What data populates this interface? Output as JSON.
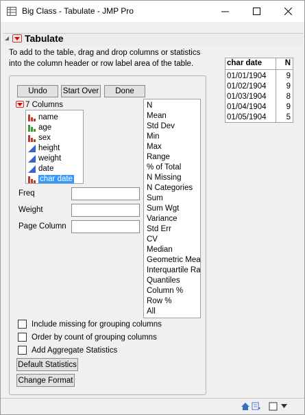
{
  "window": {
    "title": "Big Class - Tabulate - JMP Pro",
    "minimize_glyph": "—",
    "maximize_glyph": "☐",
    "close_glyph": "✕"
  },
  "outline": {
    "title": "Tabulate",
    "instructions": "To add to the table, drag and drop columns or statistics into the column header or row label area of the table."
  },
  "buttons": {
    "undo": "Undo",
    "start_over": "Start Over",
    "done": "Done",
    "default_statistics": "Default Statistics",
    "change_format": "Change Format"
  },
  "columns": {
    "header": "7 Columns",
    "items": [
      {
        "label": "name",
        "icon": "nominal-icon"
      },
      {
        "label": "age",
        "icon": "ordinal-icon"
      },
      {
        "label": "sex",
        "icon": "nominal-icon"
      },
      {
        "label": "height",
        "icon": "continuous-icon"
      },
      {
        "label": "weight",
        "icon": "continuous-icon"
      },
      {
        "label": "date",
        "icon": "continuous-icon"
      },
      {
        "label": "char date",
        "icon": "nominal-icon",
        "selected": true
      }
    ]
  },
  "roles": {
    "freq": "Freq",
    "weight": "Weight",
    "page_column": "Page Column"
  },
  "statistics": [
    "N",
    "Mean",
    "Std Dev",
    "Min",
    "Max",
    "Range",
    "% of Total",
    "N Missing",
    "N Categories",
    "Sum",
    "Sum Wgt",
    "Variance",
    "Std Err",
    "CV",
    "Median",
    "Geometric Mea",
    "Interquartile Ra",
    "Quantiles",
    "Column %",
    "Row %",
    "All"
  ],
  "options": {
    "include_missing": "Include missing for grouping columns",
    "order_by_count": "Order by count of grouping columns",
    "add_aggregate": "Add Aggregate Statistics"
  },
  "table": {
    "headers": [
      "char date",
      "N"
    ],
    "rows": [
      [
        "01/01/1904",
        "9"
      ],
      [
        "01/02/1904",
        "9"
      ],
      [
        "01/03/1904",
        "8"
      ],
      [
        "01/04/1904",
        "9"
      ],
      [
        "01/05/1904",
        "5"
      ]
    ]
  },
  "colors": {
    "nominal": "#c0392b",
    "ordinal": "#3a9a3a",
    "continuous": "#3b64c8",
    "selection": "#3399ff",
    "red_triangle": "#dd0000"
  }
}
